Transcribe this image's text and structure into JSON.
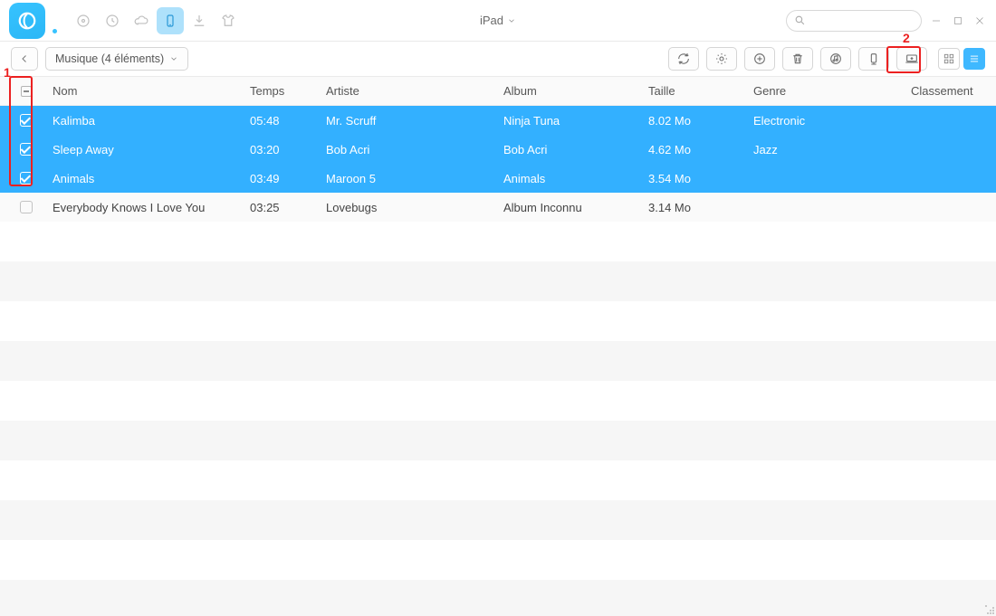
{
  "device_label": "iPad",
  "search_placeholder": "",
  "dropdown_label": "Musique (4 éléments)",
  "callouts": {
    "one": "1",
    "two": "2"
  },
  "columns": {
    "nom": "Nom",
    "temps": "Temps",
    "artiste": "Artiste",
    "album": "Album",
    "taille": "Taille",
    "genre": "Genre",
    "classement": "Classement"
  },
  "rows": [
    {
      "selected": true,
      "nom": "Kalimba",
      "temps": "05:48",
      "artiste": "Mr. Scruff",
      "album": "Ninja Tuna",
      "taille": "8.02 Mo",
      "genre": "Electronic"
    },
    {
      "selected": true,
      "nom": "Sleep Away",
      "temps": "03:20",
      "artiste": "Bob Acri",
      "album": "Bob Acri",
      "taille": "4.62 Mo",
      "genre": "Jazz"
    },
    {
      "selected": true,
      "nom": "Animals",
      "temps": "03:49",
      "artiste": "Maroon 5",
      "album": "Animals",
      "taille": "3.54 Mo",
      "genre": ""
    },
    {
      "selected": false,
      "nom": "Everybody Knows I Love You",
      "temps": "03:25",
      "artiste": "Lovebugs",
      "album": "Album Inconnu",
      "taille": "3.14 Mo",
      "genre": ""
    }
  ]
}
